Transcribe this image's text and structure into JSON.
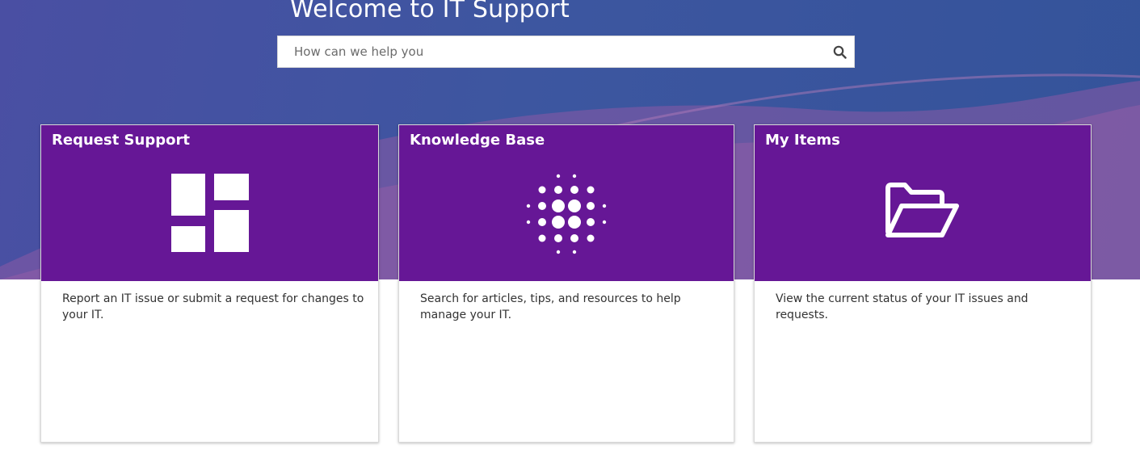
{
  "hero": {
    "title": "Welcome to IT Support"
  },
  "search": {
    "placeholder": "How can we help you",
    "icon": "search-icon"
  },
  "colors": {
    "hero_background": "#3d56a0",
    "card_header": "#661796",
    "card_title_text": "#ffffff",
    "description_text": "#333333"
  },
  "cards": [
    {
      "title": "Request Support",
      "icon": "layout-grid-icon",
      "description": "Report an IT issue or submit a request for changes to your IT."
    },
    {
      "title": "Knowledge Base",
      "icon": "dot-sphere-icon",
      "description": "Search for articles, tips, and resources to help manage your IT."
    },
    {
      "title": "My Items",
      "icon": "open-folder-icon",
      "description": "View the current status of your IT issues and requests."
    }
  ]
}
